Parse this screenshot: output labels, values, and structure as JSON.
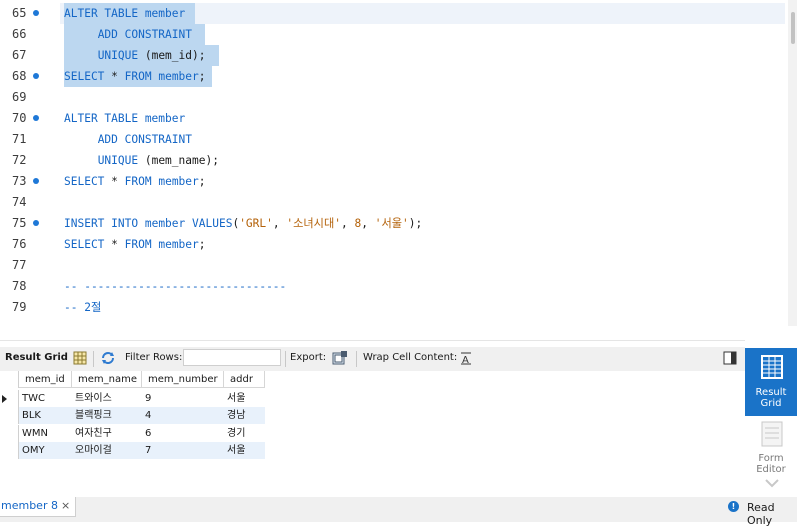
{
  "editor": {
    "lines": [
      {
        "num": "65",
        "dot": true,
        "code": [
          [
            "kw",
            "ALTER TABLE member"
          ]
        ]
      },
      {
        "num": "66",
        "dot": false,
        "code": [
          [
            "",
            "     "
          ],
          [
            "kw",
            "ADD CONSTRAINT"
          ]
        ]
      },
      {
        "num": "67",
        "dot": false,
        "code": [
          [
            "",
            "     "
          ],
          [
            "kw",
            "UNIQUE"
          ],
          [
            "",
            " (mem_id);"
          ]
        ]
      },
      {
        "num": "68",
        "dot": true,
        "code": [
          [
            "kw",
            "SELECT"
          ],
          [
            "",
            " * "
          ],
          [
            "kw",
            "FROM"
          ],
          [
            "",
            " "
          ],
          [
            "kw",
            "member"
          ],
          [
            "",
            ";"
          ]
        ]
      },
      {
        "num": "69",
        "dot": false,
        "code": []
      },
      {
        "num": "70",
        "dot": true,
        "code": [
          [
            "kw",
            "ALTER TABLE member"
          ]
        ]
      },
      {
        "num": "71",
        "dot": false,
        "code": [
          [
            "",
            "     "
          ],
          [
            "kw",
            "ADD CONSTRAINT"
          ]
        ]
      },
      {
        "num": "72",
        "dot": false,
        "code": [
          [
            "",
            "     "
          ],
          [
            "kw",
            "UNIQUE"
          ],
          [
            "",
            " (mem_name);"
          ]
        ]
      },
      {
        "num": "73",
        "dot": true,
        "code": [
          [
            "kw",
            "SELECT"
          ],
          [
            "",
            " * "
          ],
          [
            "kw",
            "FROM"
          ],
          [
            "",
            " "
          ],
          [
            "kw",
            "member"
          ],
          [
            "",
            ";"
          ]
        ]
      },
      {
        "num": "74",
        "dot": false,
        "code": []
      },
      {
        "num": "75",
        "dot": true,
        "code": [
          [
            "kw",
            "INSERT INTO"
          ],
          [
            "",
            " "
          ],
          [
            "kw",
            "member"
          ],
          [
            "",
            " "
          ],
          [
            "kw",
            "VALUES"
          ],
          [
            "",
            "("
          ],
          [
            "str",
            "'GRL'"
          ],
          [
            "",
            ", "
          ],
          [
            "str",
            "'소녀시대'"
          ],
          [
            "",
            ", "
          ],
          [
            "num",
            "8"
          ],
          [
            "",
            ", "
          ],
          [
            "str",
            "'서울'"
          ],
          [
            "",
            ");"
          ]
        ]
      },
      {
        "num": "76",
        "dot": false,
        "code": [
          [
            "kw",
            "SELECT"
          ],
          [
            "",
            " * "
          ],
          [
            "kw",
            "FROM"
          ],
          [
            "",
            " "
          ],
          [
            "kw",
            "member"
          ],
          [
            "",
            ";"
          ]
        ]
      },
      {
        "num": "77",
        "dot": false,
        "code": []
      },
      {
        "num": "78",
        "dot": false,
        "code": [
          [
            "cmt",
            "-- ------------------------------"
          ]
        ]
      },
      {
        "num": "79",
        "dot": false,
        "code": [
          [
            "cmt",
            "-- 2절"
          ]
        ]
      }
    ]
  },
  "toolbar": {
    "result_grid_label": "Result Grid",
    "filter_rows_label": "Filter Rows:",
    "filter_rows_value": "",
    "export_label": "Export:",
    "wrap_label": "Wrap Cell Content:"
  },
  "grid": {
    "columns": [
      "mem_id",
      "mem_name",
      "mem_number",
      "addr"
    ],
    "rows": [
      [
        "TWC",
        "트와이스",
        "9",
        "서울"
      ],
      [
        "BLK",
        "블랙핑크",
        "4",
        "경남"
      ],
      [
        "WMN",
        "여자친구",
        "6",
        "경기"
      ],
      [
        "OMY",
        "오마이걸",
        "7",
        "서울"
      ]
    ]
  },
  "right_panel": {
    "result_grid_label": "Result\nGrid",
    "form_editor_label": "Form\nEditor"
  },
  "status": {
    "tab_label": "member 8",
    "tab_close": "×",
    "info_icon_text": "!",
    "read_only_label": "Read Only"
  },
  "colors": {
    "keyword": "#1466c6",
    "string": "#b4620a",
    "selection": "#bcd7f0",
    "accent": "#1a73c8"
  }
}
